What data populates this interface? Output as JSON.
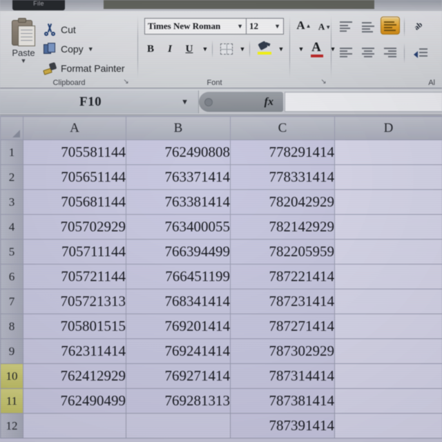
{
  "window": {
    "app": "Microsoft Excel",
    "file_tab_label": "File"
  },
  "ribbon": {
    "groups": [
      {
        "name": "clipboard",
        "label": "Clipboard",
        "paste": {
          "label": "Paste",
          "icon": "clipboard-icon",
          "caret": "▼"
        },
        "commands": [
          {
            "label": "Cut",
            "icon": "scissors-icon",
            "caret": ""
          },
          {
            "label": "Copy",
            "icon": "copy-icon",
            "caret": "▼"
          },
          {
            "label": "Format Painter",
            "icon": "paintbrush-icon",
            "caret": ""
          }
        ],
        "dialog_launcher": "↘"
      },
      {
        "name": "font",
        "label": "Font",
        "font_name": "Times New Roman",
        "font_size": "12",
        "font_name_caret": "▼",
        "font_size_caret": "▼",
        "grow_font": "A",
        "shrink_font": "A",
        "bold": "B",
        "italic": "I",
        "underline": "U",
        "underline_caret": "▼",
        "borders_caret": "▼",
        "fill_color_caret": "▼",
        "font_color_letter": "A",
        "font_color_caret": "▼",
        "fill_color_swatch": "#ffff00",
        "font_color_swatch": "#cc2222",
        "dialog_launcher": "↘"
      },
      {
        "name": "alignment",
        "label": "Al",
        "top_align": "top-align-icon",
        "middle_align": "middle-align-icon",
        "bottom_align": "bottom-align-icon",
        "align_left": "align-left-icon",
        "align_center": "align-center-icon",
        "align_right": "align-right-icon",
        "orientation": "orientation-icon",
        "decrease_indent": "decrease-indent-icon",
        "selected_align": "bottom-align-icon",
        "highlight_color": "#f5a81c"
      }
    ]
  },
  "formula_bar": {
    "name_box_value": "F10",
    "name_box_caret": "▼",
    "fx_label": "fx",
    "formula_value": "",
    "formula_placeholder": ""
  },
  "grid": {
    "select_all_icon": "select-all-triangle-icon",
    "columns": [
      "A",
      "B",
      "C",
      "D"
    ],
    "selected_rows": [
      "10",
      "11"
    ],
    "rows": [
      {
        "num": "1",
        "A": "705581144",
        "B": "762490808",
        "C": "778291414",
        "D": ""
      },
      {
        "num": "2",
        "A": "705651144",
        "B": "763371414",
        "C": "778331414",
        "D": ""
      },
      {
        "num": "3",
        "A": "705681144",
        "B": "763381414",
        "C": "782042929",
        "D": ""
      },
      {
        "num": "4",
        "A": "705702929",
        "B": "763400055",
        "C": "782142929",
        "D": ""
      },
      {
        "num": "5",
        "A": "705711144",
        "B": "766394499",
        "C": "782205959",
        "D": ""
      },
      {
        "num": "6",
        "A": "705721144",
        "B": "766451199",
        "C": "787221414",
        "D": ""
      },
      {
        "num": "7",
        "A": "705721313",
        "B": "768341414",
        "C": "787231414",
        "D": ""
      },
      {
        "num": "8",
        "A": "705801515",
        "B": "769201414",
        "C": "787271414",
        "D": ""
      },
      {
        "num": "9",
        "A": "762311414",
        "B": "769241414",
        "C": "787302929",
        "D": ""
      },
      {
        "num": "10",
        "A": "762412929",
        "B": "769271414",
        "C": "787314414",
        "D": ""
      },
      {
        "num": "11",
        "A": "762490499",
        "B": "769281313",
        "C": "787381414",
        "D": ""
      },
      {
        "num": "12",
        "A": "",
        "B": "",
        "C": "787391414",
        "D": ""
      }
    ]
  }
}
